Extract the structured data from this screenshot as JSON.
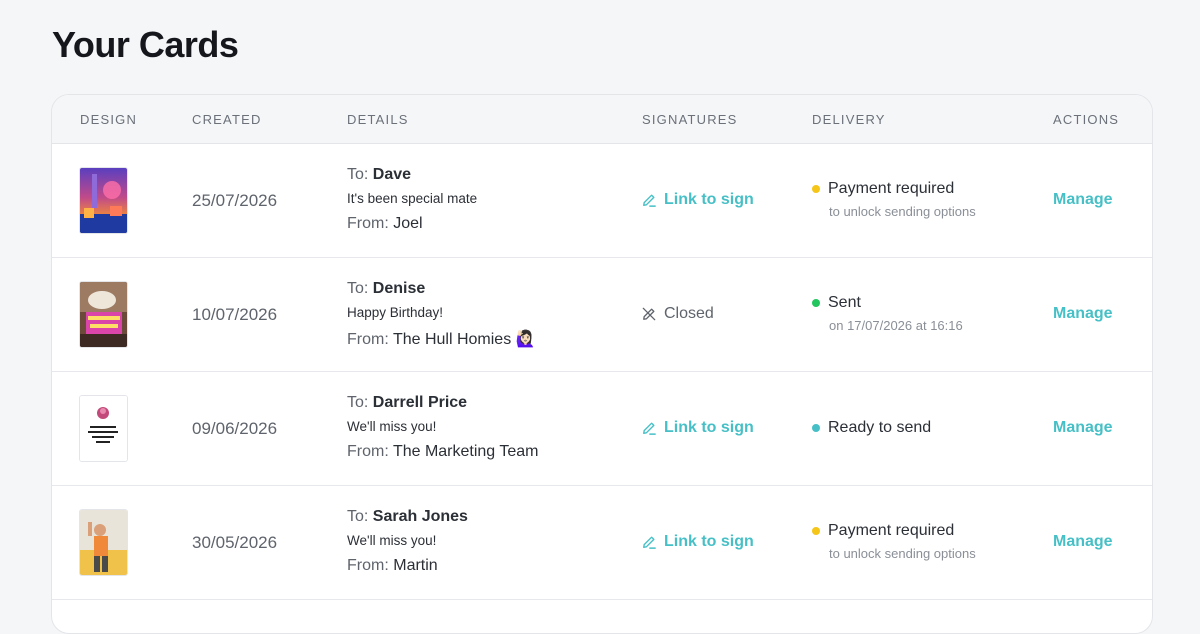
{
  "page": {
    "title": "Your Cards"
  },
  "table": {
    "headers": {
      "design": "DESIGN",
      "created": "CREATED",
      "details": "DETAILS",
      "signatures": "SIGNATURES",
      "delivery": "DELIVERY",
      "actions": "ACTIONS"
    },
    "rows": [
      {
        "created": "25/07/2026",
        "to_label": "To:",
        "to": "Dave",
        "message": "It's been special mate",
        "from_label": "From:",
        "from": "Joel",
        "signature": "Link to sign",
        "signature_icon": "pencil-icon",
        "status": "Payment required",
        "status_color": "#f5c518",
        "status_sub": "to unlock sending options",
        "action": "Manage"
      },
      {
        "created": "10/07/2026",
        "to_label": "To:",
        "to": "Denise",
        "message": "Happy Birthday!",
        "from_label": "From:",
        "from": "The Hull Homies 🙋🏻‍♀️",
        "signature": "Closed",
        "signature_icon": "pencil-off-icon",
        "status": "Sent",
        "status_color": "#22c55e",
        "status_sub": "on 17/07/2026 at 16:16",
        "action": "Manage"
      },
      {
        "created": "09/06/2026",
        "to_label": "To:",
        "to": "Darrell Price",
        "message": "We'll miss you!",
        "from_label": "From:",
        "from": "The Marketing Team",
        "signature": "Link to sign",
        "signature_icon": "pencil-icon",
        "status": "Ready to send",
        "status_color": "#46c0c6",
        "status_sub": "",
        "action": "Manage"
      },
      {
        "created": "30/05/2026",
        "to_label": "To:",
        "to": "Sarah Jones",
        "message": "We'll miss you!",
        "from_label": "From:",
        "from": "Martin",
        "signature": "Link to sign",
        "signature_icon": "pencil-icon",
        "status": "Payment required",
        "status_color": "#f5c518",
        "status_sub": "to unlock sending options",
        "action": "Manage"
      }
    ]
  },
  "colors": {
    "accent": "#46c0c6",
    "title": "#15171c"
  }
}
